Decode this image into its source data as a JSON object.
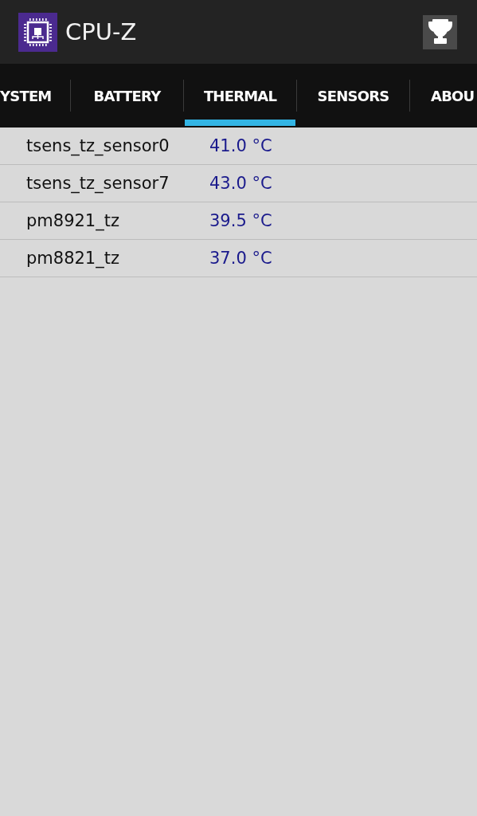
{
  "app_bar": {
    "title": "CPU-Z"
  },
  "tabs": [
    {
      "label": "YSTEM",
      "selected": false
    },
    {
      "label": "BATTERY",
      "selected": false
    },
    {
      "label": "THERMAL",
      "selected": true
    },
    {
      "label": "SENSORS",
      "selected": false
    },
    {
      "label": "ABOU",
      "selected": false
    }
  ],
  "rows": [
    {
      "name": "tsens_tz_sensor0",
      "value": "41.0 °C"
    },
    {
      "name": "tsens_tz_sensor7",
      "value": "43.0 °C"
    },
    {
      "name": "pm8921_tz",
      "value": "39.5 °C"
    },
    {
      "name": "pm8821_tz",
      "value": "37.0 °C"
    }
  ]
}
